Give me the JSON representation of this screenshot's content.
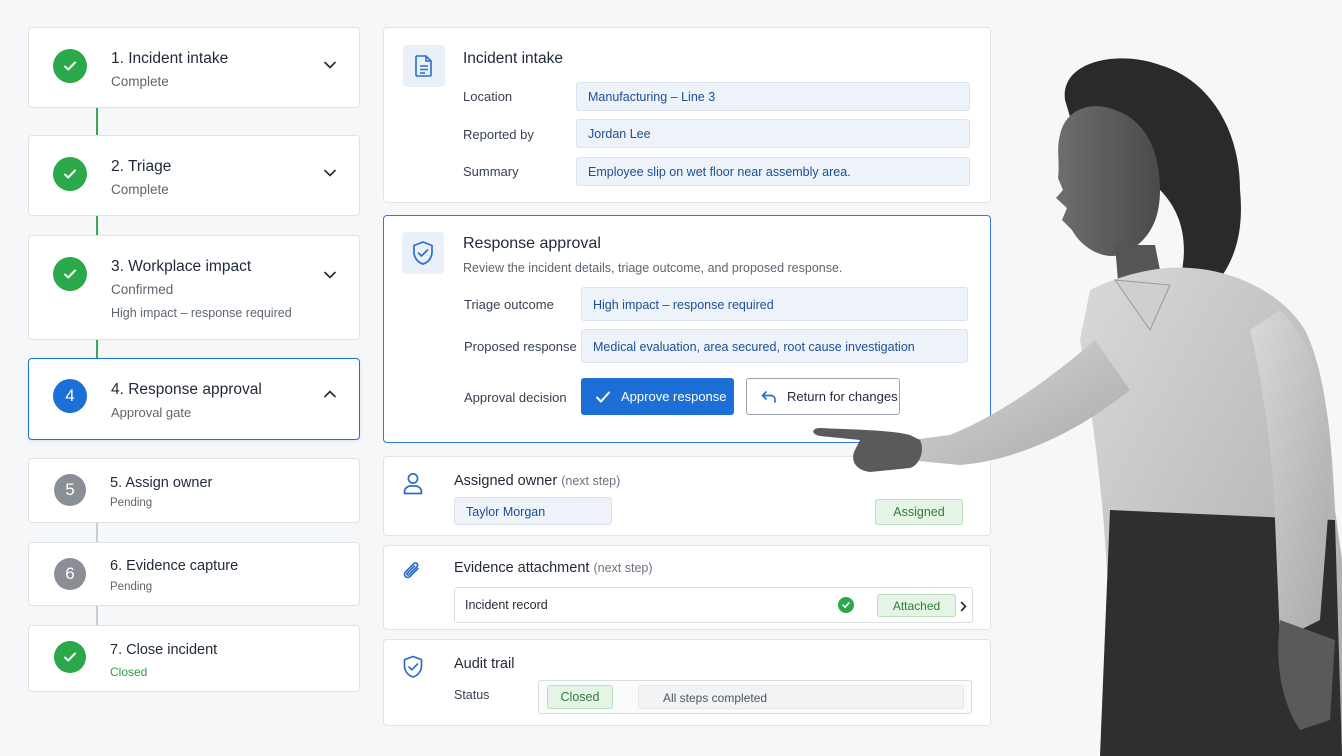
{
  "stepper": {
    "steps": [
      {
        "num": "1",
        "title": "1. Incident intake",
        "status": "Complete",
        "state": "done"
      },
      {
        "num": "2",
        "title": "2. Triage",
        "status": "Complete",
        "state": "done"
      },
      {
        "num": "3",
        "title": "3. Workplace impact",
        "status": "Confirmed",
        "detail": "High impact – response required",
        "state": "done"
      },
      {
        "num": "4",
        "title": "4. Response approval",
        "status": "Approval gate",
        "state": "current"
      },
      {
        "num": "5",
        "title": "5. Assign owner",
        "status": "Pending",
        "state": "pending"
      },
      {
        "num": "6",
        "title": "6. Evidence capture",
        "status": "Pending",
        "state": "pending"
      },
      {
        "num": "7",
        "title": "7. Close incident",
        "status": "Closed",
        "state": "done"
      }
    ]
  },
  "intake": {
    "title": "Incident intake",
    "location_label": "Location",
    "location_value": "Manufacturing – Line 3",
    "reported_label": "Reported by",
    "reported_value": "Jordan Lee",
    "summary_label": "Summary",
    "summary_value": "Employee slip on wet floor near assembly area."
  },
  "approval": {
    "title": "Response approval",
    "description": "Review the incident details, triage outcome, and proposed response.",
    "triage_label": "Triage outcome",
    "triage_value": "High impact – response required",
    "proposed_label": "Proposed response",
    "proposed_value": "Medical evaluation, area secured, root cause investigation",
    "decision_label": "Approval decision",
    "approve_button": "Approve response",
    "return_button": "Return for changes"
  },
  "owner": {
    "title": "Assigned owner",
    "note": "(next step)",
    "value": "Taylor Morgan",
    "badge": "Assigned"
  },
  "evidence": {
    "title": "Evidence attachment",
    "note": "(next step)",
    "record": "Incident record",
    "badge": "Attached"
  },
  "audit": {
    "title": "Audit trail",
    "status_label": "Status",
    "status_badge": "Closed",
    "status_text": "All steps completed"
  },
  "colors": {
    "primary": "#1b6fd6",
    "success": "#2aa84a",
    "pending": "#8a8f95"
  }
}
